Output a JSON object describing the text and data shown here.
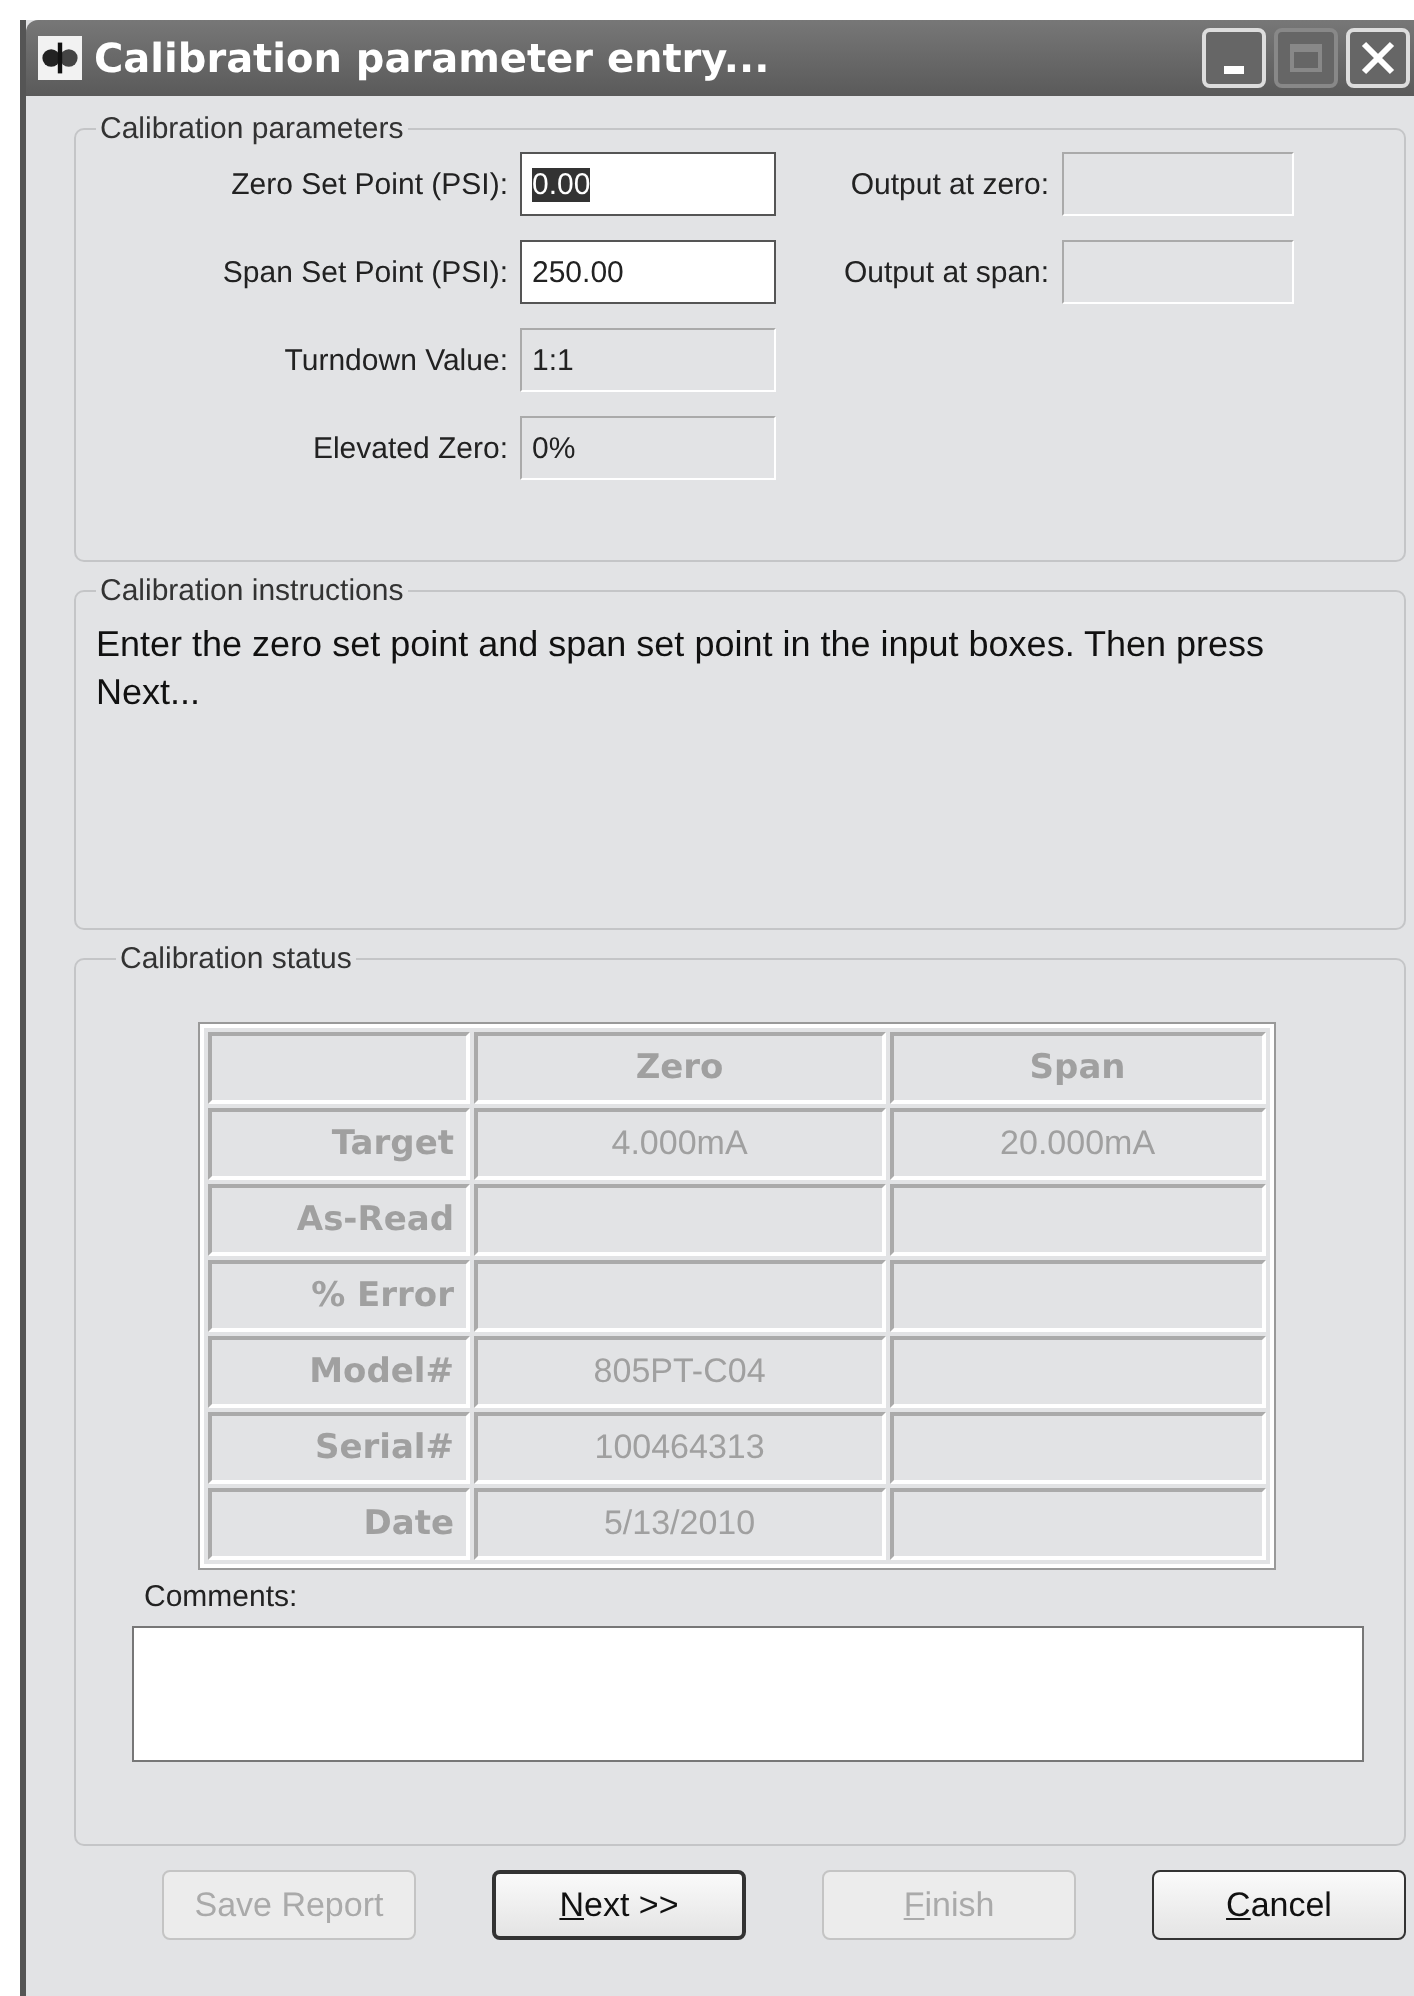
{
  "window": {
    "title": "Calibration parameter entry..."
  },
  "parameters": {
    "title": "Calibration parameters",
    "fields": [
      {
        "label": "Zero Set Point (PSI):",
        "value": "0.00",
        "editable": true,
        "text_selected": true
      },
      {
        "label": "Span Set Point (PSI):",
        "value": "250.00",
        "editable": true,
        "text_selected": false
      },
      {
        "label": "Turndown Value:",
        "value": "1:1",
        "editable": false,
        "text_selected": false
      },
      {
        "label": "Elevated Zero:",
        "value": "0%",
        "editable": false,
        "text_selected": false
      }
    ],
    "outputs": [
      {
        "label": "Output at zero:"
      },
      {
        "label": "Output at span:"
      }
    ]
  },
  "instructions": {
    "title": "Calibration instructions",
    "text": "Enter the zero set point and span set point in the input boxes.  Then press Next..."
  },
  "status": {
    "title": "Calibration status",
    "table": {
      "columns": [
        "Zero",
        "Span"
      ],
      "rows": [
        {
          "label": "Target",
          "cells": [
            "4.000mA",
            "20.000mA"
          ]
        },
        {
          "label": "As-Read",
          "cells": [
            "",
            ""
          ]
        },
        {
          "label": "% Error",
          "cells": [
            "",
            ""
          ]
        },
        {
          "label": "Model#",
          "cells": [
            "805PT-C04",
            ""
          ]
        },
        {
          "label": "Serial#",
          "cells": [
            "100464313",
            ""
          ]
        },
        {
          "label": "Date",
          "cells": [
            "5/13/2010",
            ""
          ]
        }
      ]
    },
    "comments_label": "Comments:"
  },
  "buttons": [
    {
      "label": "Save Report",
      "disabled": true,
      "default": false,
      "mnemonic": false
    },
    {
      "label": "Next >>",
      "disabled": false,
      "default": true,
      "mnemonic": true
    },
    {
      "label": "Finish",
      "disabled": true,
      "default": false,
      "mnemonic": true
    },
    {
      "label": "Cancel",
      "disabled": false,
      "default": false,
      "mnemonic": true
    }
  ]
}
